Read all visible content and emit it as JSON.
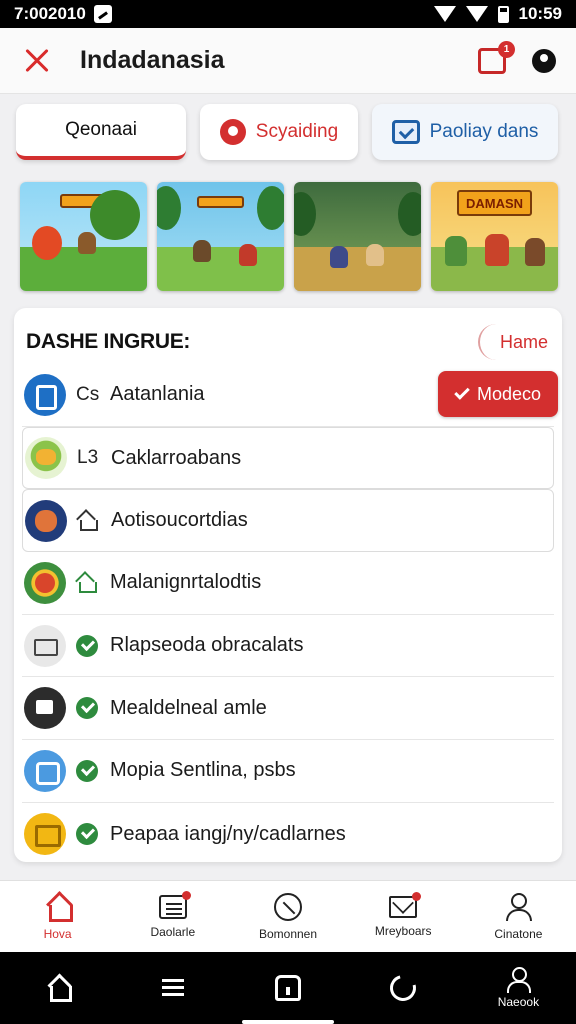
{
  "status_bar": {
    "time": "7:002010",
    "clock": "10:59"
  },
  "app_bar": {
    "title": "Indadanasia",
    "notification_badge": "1"
  },
  "filter_chips": [
    {
      "label": "Qeonaai"
    },
    {
      "label": "Scyaiding"
    },
    {
      "label": "Paoliay dans"
    }
  ],
  "game_tiles": [
    {
      "name": "game-tile-1"
    },
    {
      "name": "game-tile-2"
    },
    {
      "name": "game-tile-3"
    },
    {
      "name": "game-tile-4",
      "banner": "DAMASN"
    }
  ],
  "panel": {
    "title": "DASHE INGRUE:",
    "name_button": "Hame",
    "mode_button": "Modeco",
    "rows": [
      {
        "lead": "Cs",
        "text": "Aatanlania"
      },
      {
        "lead": "L3",
        "text": "Caklarroabans"
      },
      {
        "lead": "",
        "text": "Aotisoucortdias"
      },
      {
        "lead": "",
        "text": "Malanignrtalodtis"
      },
      {
        "lead": "",
        "text": "Rlapseoda obracalats"
      },
      {
        "lead": "",
        "text": "Mealdelneal amle"
      },
      {
        "lead": "",
        "text": "Mopia Sentlina, psbs"
      },
      {
        "lead": "",
        "text": "Peapaa iangj/ny/cadlarnes"
      }
    ]
  },
  "bottom_nav": [
    {
      "label": "Hova"
    },
    {
      "label": "Daolarle"
    },
    {
      "label": "Bomonnen"
    },
    {
      "label": "Mreyboars"
    },
    {
      "label": "Cinatone"
    }
  ],
  "system_nav": {
    "profile_label": "Naeook"
  },
  "colors": {
    "accent": "#d32f2f",
    "secondary": "#1f5fa6",
    "success": "#2e8b3e"
  }
}
